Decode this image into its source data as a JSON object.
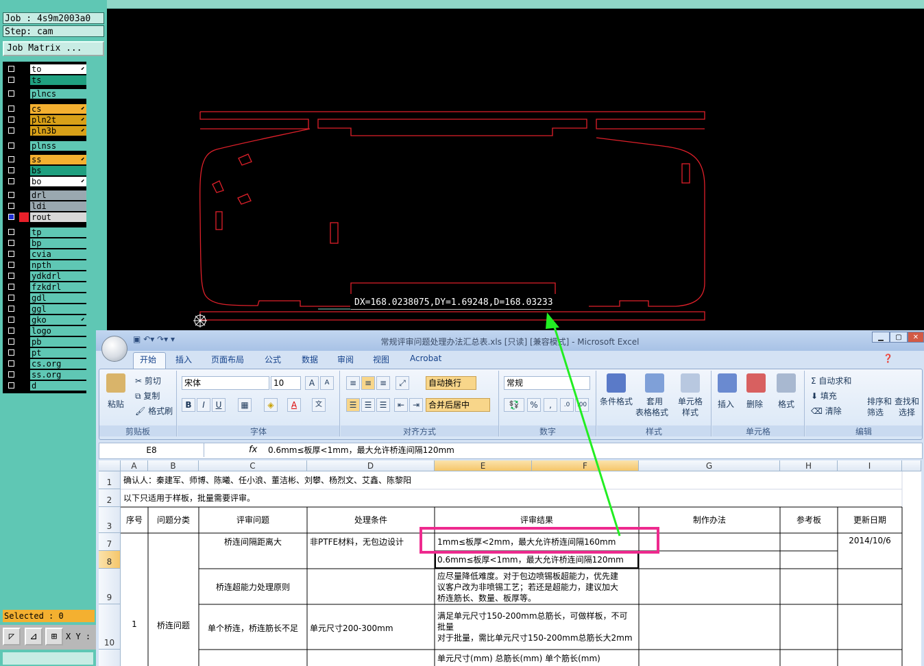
{
  "cam": {
    "job_label": "Job : 4s9m2003a0",
    "step_label": "Step: cam",
    "job_matrix_button": "Job Matrix ...",
    "layers": [
      {
        "name": "to",
        "color": "#ffffff",
        "arrow": true
      },
      {
        "name": "ts",
        "color": "#20a080",
        "arrow": false
      },
      {
        "name": "plncs",
        "color": "#5fc7b4",
        "arrow": false
      },
      {
        "name": "cs",
        "color": "#f4b030",
        "arrow": true
      },
      {
        "name": "pln2t",
        "color": "#d8a018",
        "arrow": true
      },
      {
        "name": "pln3b",
        "color": "#d8a018",
        "arrow": true
      },
      {
        "name": "plnss",
        "color": "#5fc7b4",
        "arrow": false
      },
      {
        "name": "ss",
        "color": "#f4b030",
        "arrow": true
      },
      {
        "name": "bs",
        "color": "#20a080",
        "arrow": false
      },
      {
        "name": "bo",
        "color": "#ffffff",
        "arrow": true
      },
      {
        "name": "drl",
        "color": "#9aa8b0",
        "arrow": false
      },
      {
        "name": "ldi",
        "color": "#9aa8b0",
        "arrow": false
      },
      {
        "name": "rout",
        "color": "#d8d8d8",
        "arrow": false
      },
      {
        "name": "tp",
        "color": "#5fc7b4",
        "arrow": false
      },
      {
        "name": "bp",
        "color": "#5fc7b4",
        "arrow": false
      },
      {
        "name": "cvia",
        "color": "#5fc7b4",
        "arrow": false
      },
      {
        "name": "npth",
        "color": "#5fc7b4",
        "arrow": false
      },
      {
        "name": "ydkdrl",
        "color": "#5fc7b4",
        "arrow": false
      },
      {
        "name": "fzkdrl",
        "color": "#5fc7b4",
        "arrow": false
      },
      {
        "name": "gdl",
        "color": "#5fc7b4",
        "arrow": false
      },
      {
        "name": "ggl",
        "color": "#5fc7b4",
        "arrow": false
      },
      {
        "name": "gko",
        "color": "#5fc7b4",
        "arrow": true
      },
      {
        "name": "logo",
        "color": "#5fc7b4",
        "arrow": false
      },
      {
        "name": "pb",
        "color": "#5fc7b4",
        "arrow": false
      },
      {
        "name": "pt",
        "color": "#5fc7b4",
        "arrow": false
      },
      {
        "name": "cs.org",
        "color": "#5fc7b4",
        "arrow": false
      },
      {
        "name": "ss.org",
        "color": "#5fc7b4",
        "arrow": false
      },
      {
        "name": "d",
        "color": "#5fc7b4",
        "arrow": false
      }
    ],
    "selected_label": "Selected : 0",
    "xy_label": "X Y :",
    "measure_text": "DX=168.0238075,DY=1.69248,D=168.03233"
  },
  "excel": {
    "title": "常规评审问题处理办法汇总表.xls  [只读]  [兼容模式] - Microsoft Excel",
    "tabs": [
      "开始",
      "插入",
      "页面布局",
      "公式",
      "数据",
      "审阅",
      "视图",
      "Acrobat"
    ],
    "ribbon": {
      "paste": "粘贴",
      "cut": "剪切",
      "copy": "复制",
      "format_painter": "格式刷",
      "clipboard": "剪贴板",
      "font_name": "宋体",
      "font_size": "10",
      "font_group": "字体",
      "wrap_text": "自动换行",
      "merge_center": "合并后居中",
      "alignment_group": "对齐方式",
      "number_format": "常规",
      "number_group": "数字",
      "cond_format": "条件格式",
      "table_format_1": "套用",
      "table_format_2": "表格格式",
      "cell_style_1": "单元格",
      "cell_style_2": "样式",
      "styles_group": "样式",
      "insert": "插入",
      "delete": "删除",
      "format": "格式",
      "cells_group": "单元格",
      "autosum": "自动求和",
      "fill": "填充",
      "clear": "清除",
      "sort_1": "排序和",
      "sort_2": "筛选",
      "find_1": "查找和",
      "find_2": "选择",
      "editing_group": "编辑"
    },
    "name_box": "E8",
    "formula": "0.6mm≤板厚<1mm，最大允许桥连间隔120mm",
    "columns": [
      "A",
      "B",
      "C",
      "D",
      "E",
      "F",
      "G",
      "H",
      "I"
    ],
    "rows": [
      "1",
      "2",
      "3",
      "7",
      "8",
      "9",
      "10"
    ],
    "cells": {
      "r1": "确认人：秦建军、师博、陈曦、任小浪、董洁彬、刘攀、杨烈文、艾鑫、陈黎阳",
      "r2": "以下只适用于样板，批量需要评审。",
      "h_a": "序号",
      "h_b": "问题分类",
      "h_c": "评审问题",
      "h_d": "处理条件",
      "h_e": "评审结果",
      "h_g": "制作办法",
      "h_h": "参考板",
      "h_i": "更新日期",
      "a_no": "1",
      "b_cat": "桥连问题",
      "c7": "桥连间隔距离大",
      "d7": "非PTFE材料，无包边设计",
      "e7": "1mm≤板厚<2mm，最大允许桥连间隔160mm",
      "i7": "2014/10/6",
      "e8": "0.6mm≤板厚<1mm，最大允许桥连间隔120mm",
      "c9": "桥连超能力处理原则",
      "e9_1": "应尽量降低难度。对于包边喷锡板超能力，优先建",
      "e9_2": "议客户改为非喷锡工艺；若还是超能力，建议加大",
      "e9_3": "桥连筋长、数量、板厚等。",
      "c10": "单个桥连，桥连筋长不足",
      "d10": "单元尺寸200-300mm",
      "e10_1": "满足单元尺寸150-200mm总筋长，可做样板，不可",
      "e10_2": "批量",
      "e10_3": "对于批量，需比单元尺寸150-200mm总筋长大2mm",
      "e11": "单元尺寸(mm)    总筋长(mm)    单个筋长(mm)"
    }
  }
}
